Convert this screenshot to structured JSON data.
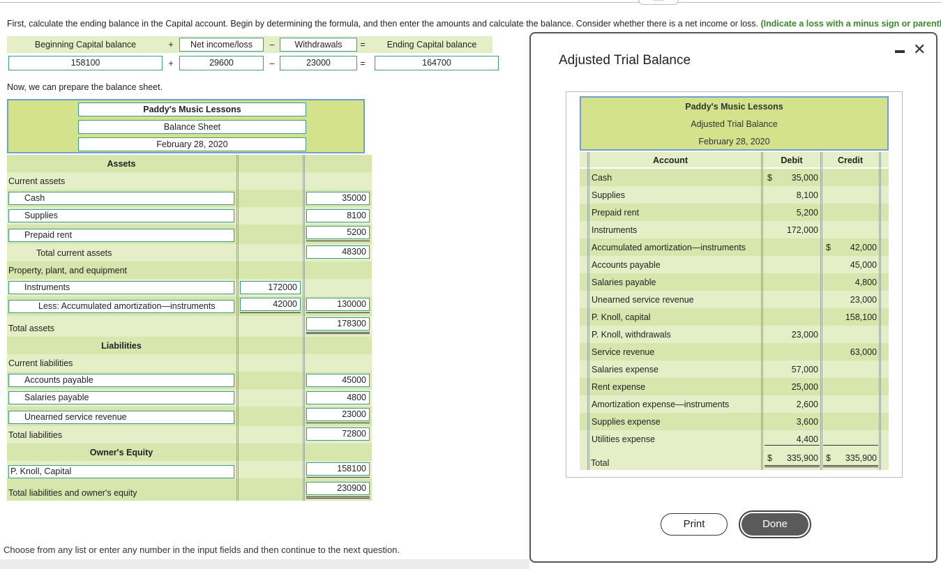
{
  "instruction": {
    "text": "First, calculate the ending balance in the Capital account. Begin by determining the formula, and then enter the amounts and calculate the balance. Consider whether there is a net income or loss. ",
    "emphasis": "(Indicate a loss with a minus sign or parentheses.)"
  },
  "formula": {
    "h1": "Beginning Capital balance",
    "op1": "+",
    "h2": "Net income/loss",
    "op2": "–",
    "h3": "Withdrawals",
    "op3": "=",
    "h4": "Ending Capital balance",
    "v1": "158100",
    "v2": "29600",
    "v3": "23000",
    "v4": "164700"
  },
  "prep_text": "Now, we can prepare the balance sheet.",
  "balance_sheet": {
    "company": "Paddy's Music Lessons",
    "statement": "Balance Sheet",
    "date": "February 28, 2020",
    "assets_heading": "Assets",
    "current_assets": "Current assets",
    "cash_label": "Cash",
    "cash_value": "35000",
    "supplies_label": "Supplies",
    "supplies_value": "8100",
    "prepaid_label": "Prepaid rent",
    "prepaid_value": "5200",
    "total_current_label": "Total current assets",
    "total_current_value": "48300",
    "ppe_label": "Property, plant, and equipment",
    "instruments_label": "Instruments",
    "instruments_value": "172000",
    "accum_label": "Less: Accumulated amortization—instruments",
    "accum_value": "42000",
    "net_ppe_value": "130000",
    "total_assets_label": "Total assets",
    "total_assets_value": "178300",
    "liabilities_heading": "Liabilities",
    "current_liabilities": "Current liabilities",
    "ap_label": "Accounts payable",
    "ap_value": "45000",
    "sp_label": "Salaries payable",
    "sp_value": "4800",
    "usr_label": "Unearned service revenue",
    "usr_value": "23000",
    "total_liab_label": "Total liabilities",
    "total_liab_value": "72800",
    "equity_heading": "Owner's Equity",
    "capital_label": "P. Knoll, Capital",
    "capital_value": "158100",
    "total_le_label": "Total liabilities and owner's equity",
    "total_le_value": "230900"
  },
  "bottom_text": "Choose from any list or enter any number in the input fields and then continue to the next question.",
  "modal": {
    "title": "Adjusted Trial Balance",
    "close_symbol": "✕",
    "company": "Paddy's Music Lessons",
    "statement": "Adjusted Trial Balance",
    "date": "February 28, 2020",
    "col_account": "Account",
    "col_debit": "Debit",
    "col_credit": "Credit",
    "currency": "$",
    "rows": [
      {
        "account": "Cash",
        "debit": "35,000",
        "credit": ""
      },
      {
        "account": "Supplies",
        "debit": "8,100",
        "credit": ""
      },
      {
        "account": "Prepaid rent",
        "debit": "5,200",
        "credit": ""
      },
      {
        "account": "Instruments",
        "debit": "172,000",
        "credit": ""
      },
      {
        "account": "Accumulated amortization—instruments",
        "debit": "",
        "credit": "42,000"
      },
      {
        "account": "Accounts payable",
        "debit": "",
        "credit": "45,000"
      },
      {
        "account": "Salaries payable",
        "debit": "",
        "credit": "4,800"
      },
      {
        "account": "Unearned service revenue",
        "debit": "",
        "credit": "23,000"
      },
      {
        "account": "P. Knoll, capital",
        "debit": "",
        "credit": "158,100"
      },
      {
        "account": "P. Knoll, withdrawals",
        "debit": "23,000",
        "credit": ""
      },
      {
        "account": "Service revenue",
        "debit": "",
        "credit": "63,000"
      },
      {
        "account": "Salaries expense",
        "debit": "57,000",
        "credit": ""
      },
      {
        "account": "Rent expense",
        "debit": "25,000",
        "credit": ""
      },
      {
        "account": "Amortization expense—instruments",
        "debit": "2,600",
        "credit": ""
      },
      {
        "account": "Supplies expense",
        "debit": "3,600",
        "credit": ""
      },
      {
        "account": "Utilities expense",
        "debit": "4,400",
        "credit": ""
      }
    ],
    "total_label": "Total",
    "total_debit": "335,900",
    "total_credit": "335,900",
    "print_label": "Print",
    "done_label": "Done"
  }
}
